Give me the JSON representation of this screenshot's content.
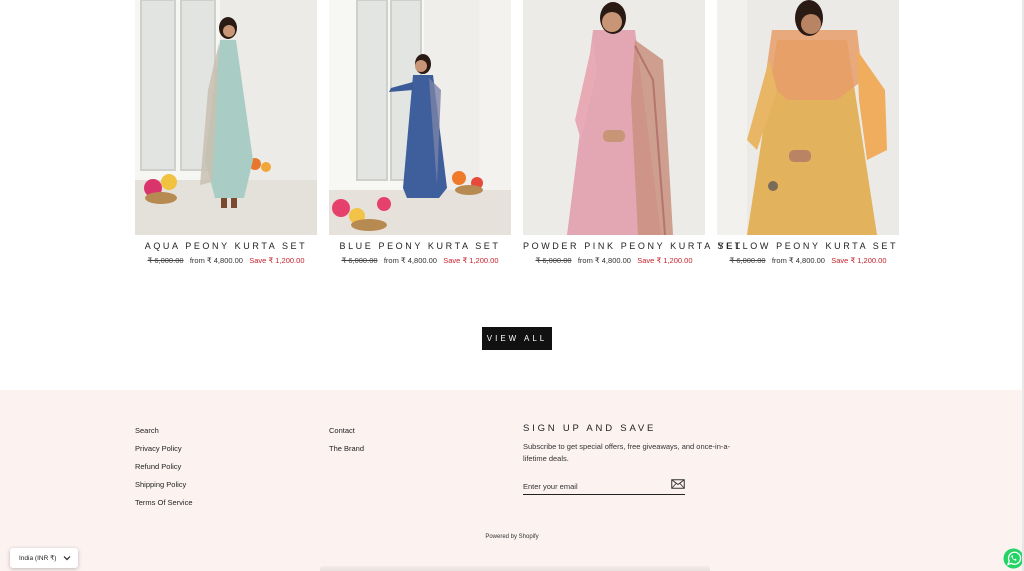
{
  "products": [
    {
      "title": "AQUA PEONY KURTA SET",
      "compare_price": "₹ 6,000.00",
      "from_label": "from",
      "price": "₹ 4,800.00",
      "save_label": "Save",
      "save_amount": "₹ 1,200.00",
      "dress_color": "#a9cdc4"
    },
    {
      "title": "BLUE PEONY KURTA SET",
      "compare_price": "₹ 6,000.00",
      "from_label": "from",
      "price": "₹ 4,800.00",
      "save_label": "Save",
      "save_amount": "₹ 1,200.00",
      "dress_color": "#3f5e9c"
    },
    {
      "title": "POWDER PINK PEONY KURTA SET",
      "compare_price": "₹ 6,000.00",
      "from_label": "from",
      "price": "₹ 4,800.00",
      "save_label": "Save",
      "save_amount": "₹ 1,200.00",
      "dress_color": "#e3a7b4"
    },
    {
      "title": "YELLOW PEONY KURTA SET",
      "compare_price": "₹ 6,000.00",
      "from_label": "from",
      "price": "₹ 4,800.00",
      "save_label": "Save",
      "save_amount": "₹ 1,200.00",
      "dress_color": "#e3b25c"
    }
  ],
  "view_all_label": "VIEW ALL",
  "footer": {
    "links_col1": [
      "Search",
      "Privacy Policy",
      "Refund Policy",
      "Shipping Policy",
      "Terms Of Service"
    ],
    "links_col2": [
      "Contact",
      "The Brand"
    ],
    "signup_title": "SIGN UP AND SAVE",
    "signup_text": "Subscribe to get special offers, free giveaways, and once-in-a-lifetime deals.",
    "email_placeholder": "Enter your email",
    "powered_by": "Powered by Shopify"
  },
  "currency_selector": "India (INR ₹)",
  "icons": {
    "submit": "envelope-icon",
    "chevron": "chevron-down-icon",
    "chat": "whatsapp-icon"
  },
  "colors": {
    "footer_bg": "#fcf3f1",
    "sale_red": "#c8232b",
    "button_bg": "#111111",
    "whatsapp_green": "#25d366"
  }
}
